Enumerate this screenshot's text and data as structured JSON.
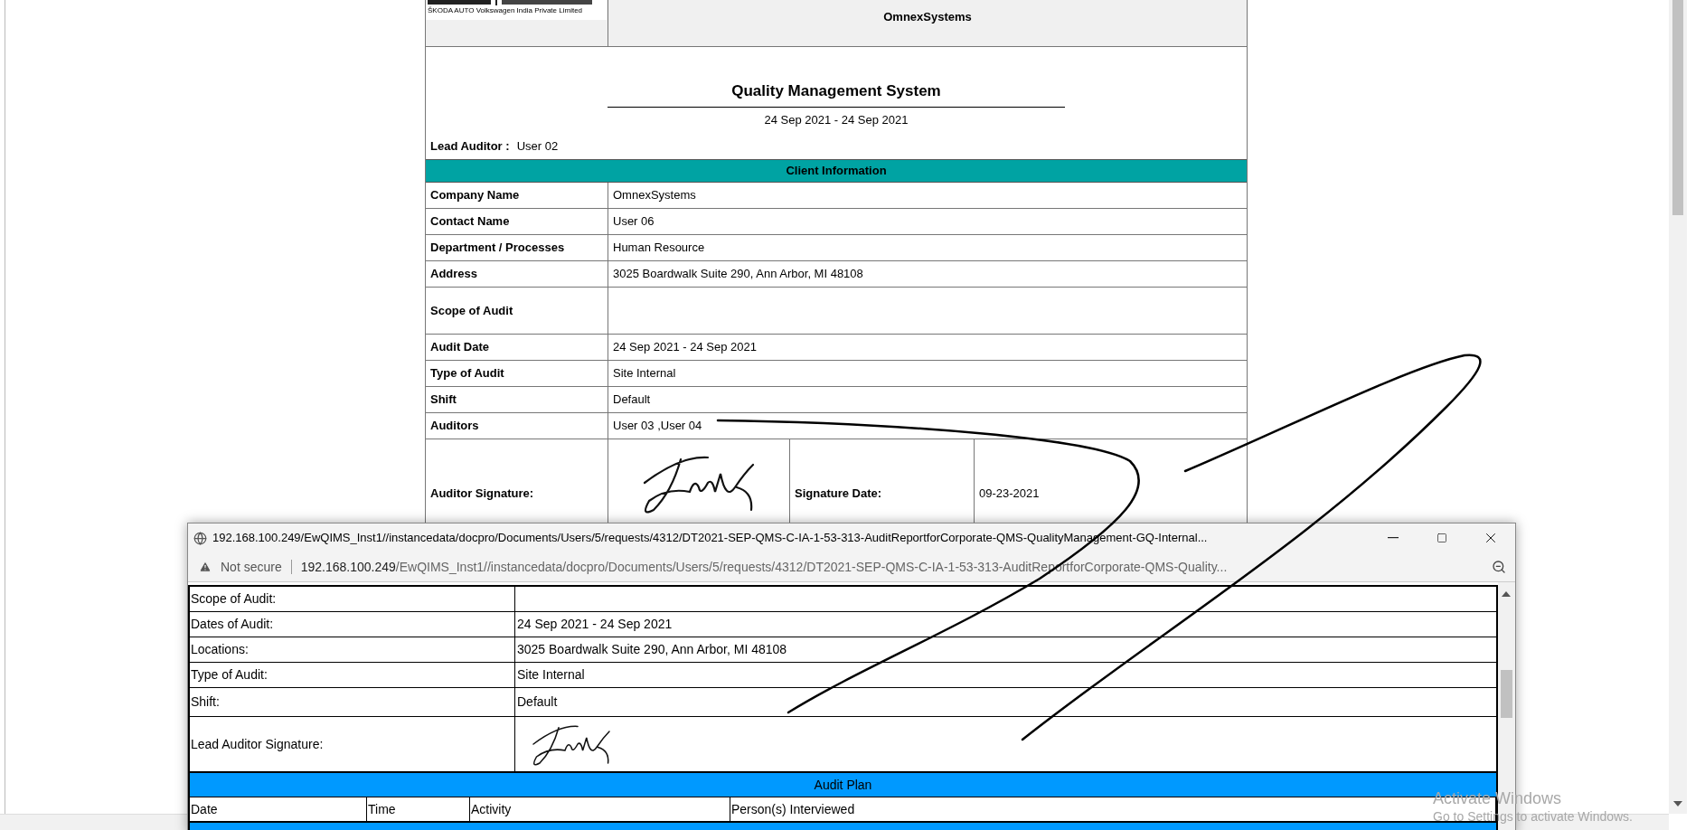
{
  "document": {
    "logo_caption": "ŠKODA AUTO Volkswagen India Private Limited",
    "company": "OmnexSystems",
    "title": "Quality Management System",
    "date_range": "24 Sep 2021 - 24 Sep 2021",
    "lead_auditor": {
      "label": "Lead Auditor :",
      "value": "User 02"
    },
    "client_information": {
      "heading": "Client Information",
      "rows": [
        {
          "label": "Company Name",
          "value": "OmnexSystems"
        },
        {
          "label": "Contact Name",
          "value": "User 06"
        },
        {
          "label": "Department / Processes",
          "value": "Human Resource"
        },
        {
          "label": "Address",
          "value": "3025 Boardwalk Suite 290, Ann Arbor, MI 48108"
        },
        {
          "label": "Scope of Audit"
        },
        {
          "label": "Audit Date",
          "value": "24 Sep 2021 - 24 Sep 2021"
        },
        {
          "label": "Type of Audit",
          "value": "Site Internal"
        },
        {
          "label": "Shift",
          "value": "Default"
        },
        {
          "label": "Auditors",
          "value": "User 03 ,User 04"
        }
      ]
    },
    "signature_row": {
      "label": "Auditor Signature:",
      "date_label": "Signature Date:",
      "date": "09-23-2021"
    }
  },
  "popup": {
    "title": "192.168.100.249/EwQIMS_Inst1//instancedata/docpro/Documents/Users/5/requests/4312/DT2021-SEP-QMS-C-IA-1-53-313-AuditReportforCorporate-QMS-QualityManagement-GQ-Internal...",
    "security": "Not secure",
    "url_host": "192.168.100.249",
    "url_path": "/EwQIMS_Inst1//instancedata/docpro/Documents/Users/5/requests/4312/DT2021-SEP-QMS-C-IA-1-53-313-AuditReportforCorporate-QMS-Quality...",
    "rows": [
      {
        "label": "Scope of Audit:"
      },
      {
        "label": "Dates of Audit:",
        "value": "24 Sep 2021 - 24 Sep 2021"
      },
      {
        "label": "Locations:",
        "value": "3025 Boardwalk Suite 290, Ann Arbor, MI 48108"
      },
      {
        "label": "Type of Audit:",
        "value": "Site Internal"
      },
      {
        "label": "Shift:",
        "value": "Default"
      }
    ],
    "signature_label": "Lead Auditor Signature:",
    "audit_plan": {
      "heading": "Audit Plan",
      "columns": [
        "Date",
        "Time",
        "Activity",
        "Person(s) Interviewed"
      ]
    }
  },
  "os_notice": {
    "title": "Activate Windows",
    "subtitle": "Go to Settings to activate Windows."
  }
}
